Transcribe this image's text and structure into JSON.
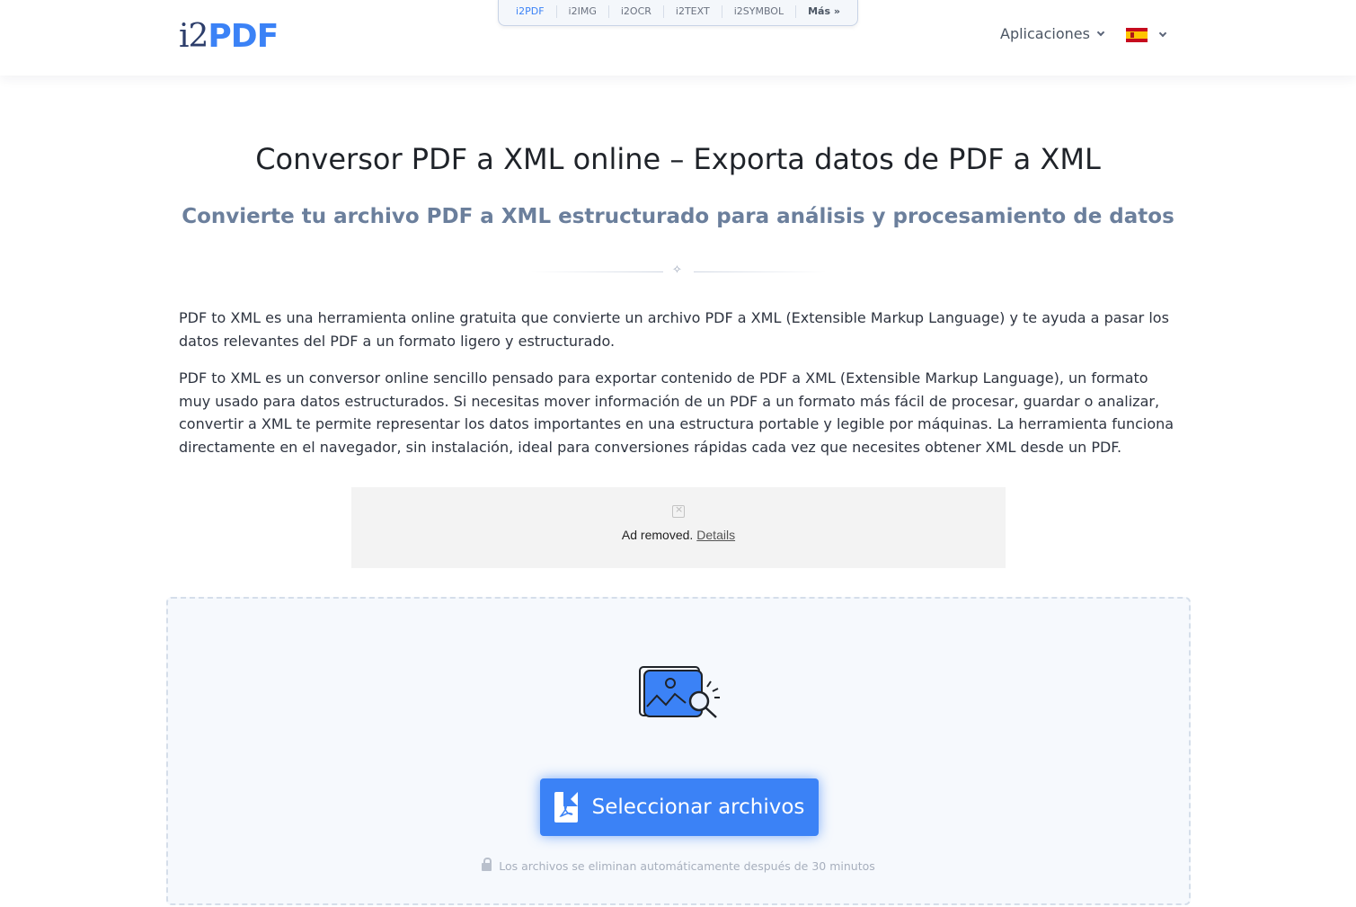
{
  "header": {
    "logo_i2": "i2",
    "logo_pdf": "PDF",
    "topnav": [
      "i2PDF",
      "i2IMG",
      "i2OCR",
      "i2TEXT",
      "i2SYMBOL",
      "Más »"
    ],
    "apps_label": "Aplicaciones",
    "language_flag": "flag-es-icon"
  },
  "main": {
    "title": "Conversor PDF a XML online – Exporta datos de PDF a XML",
    "subtitle": "Convierte tu archivo PDF a XML estructurado para análisis y procesamiento de datos",
    "paragraph_1": "PDF to XML es una herramienta online gratuita que convierte un archivo PDF a XML (Extensible Markup Language) y te ayuda a pasar los datos relevantes del PDF a un formato ligero y estructurado.",
    "paragraph_2": "PDF to XML es un conversor online sencillo pensado para exportar contenido de PDF a XML (Extensible Markup Language), un formato muy usado para datos estructurados. Si necesitas mover información de un PDF a un formato más fácil de procesar, guardar o analizar, convertir a XML te permite representar los datos importantes en una estructura portable y legible por máquinas. La herramienta funciona directamente en el navegador, sin instalación, ideal para conversiones rápidas cada vez que necesites obtener XML desde un PDF."
  },
  "ad": {
    "text": "Ad removed.",
    "link": "Details"
  },
  "upload": {
    "button_label": "Seleccionar archivos",
    "note": "Los archivos se eliminan automáticamente después de 30 minutos"
  },
  "colors": {
    "accent": "#3b82f6",
    "logo_dark": "#2d3e6b",
    "subtitle": "#6b7f9c"
  }
}
